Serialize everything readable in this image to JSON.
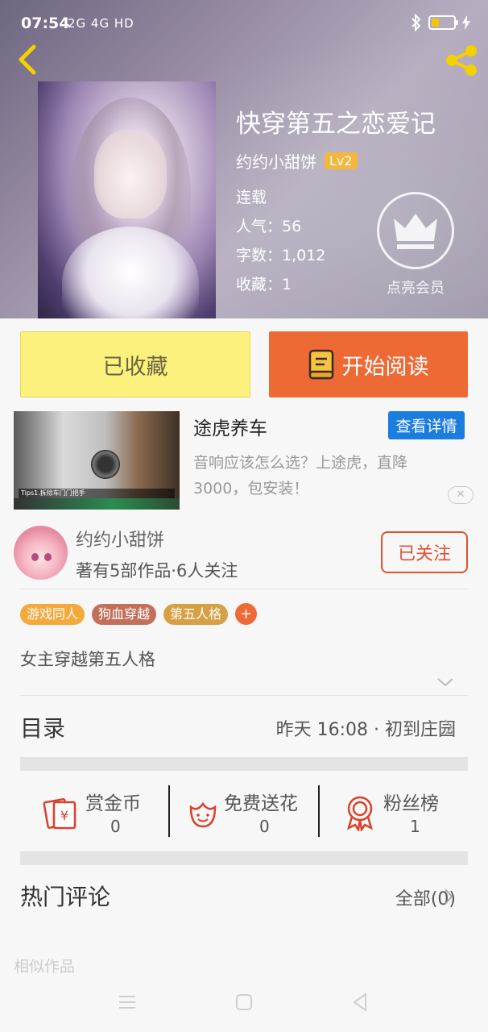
{
  "status_bar": {
    "time": "07:54",
    "network": "2G 4G HD"
  },
  "book": {
    "title": "快穿第五之恋爱记",
    "author": "约约小甜饼",
    "level": "Lv2",
    "status": "连载",
    "popularity": "人气：56",
    "word_count": "字数：1,012",
    "favorites": "收藏：1",
    "vip_label": "点亮会员"
  },
  "actions": {
    "collected": "已收藏",
    "start_reading": "开始阅读"
  },
  "ad": {
    "title": "途虎养车",
    "detail_button": "查看详情",
    "description": "音响应该怎么选？上途虎，直降3000，包安装！",
    "image_caption": "Tips1.拆除车门门把手"
  },
  "author_card": {
    "name": "约约小甜饼",
    "stats": "著有5部作品·6人关注",
    "follow_label": "已关注"
  },
  "tags": [
    {
      "label": "游戏同人",
      "color": "#f4a93c"
    },
    {
      "label": "狗血穿越",
      "color": "#c2705b"
    },
    {
      "label": "第五人格",
      "color": "#d6a044"
    }
  ],
  "tag_add": "+",
  "summary": "女主穿越第五人格",
  "toc": {
    "title": "目录",
    "latest": "昨天 16:08 · 初到庄园"
  },
  "stats": [
    {
      "label": "赏金币",
      "value": "0",
      "icon": "reward-coin-icon"
    },
    {
      "label": "免费送花",
      "value": "0",
      "icon": "flower-icon"
    },
    {
      "label": "粉丝榜",
      "value": "1",
      "icon": "medal-icon"
    }
  ],
  "comments": {
    "title": "热门评论",
    "all": "全部(0)"
  },
  "similar": "相似作品",
  "colors": {
    "accent": "#ee6a35",
    "collect_bg": "#fdf17e",
    "ad_button": "#1b7de0",
    "icon_red": "#d8412b"
  }
}
